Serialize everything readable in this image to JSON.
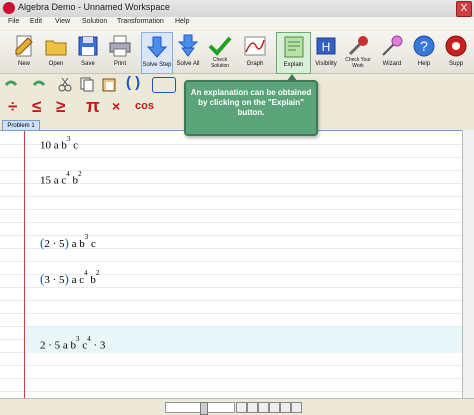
{
  "window": {
    "title": "Algebra Demo - Unnamed Workspace",
    "close": "X"
  },
  "menu": [
    "File",
    "Edit",
    "View",
    "Solution",
    "Transformation",
    "Help"
  ],
  "toolbar": {
    "new": "New",
    "open": "Open",
    "save": "Save",
    "print": "Print",
    "solve_step": "Solve Step",
    "solve_all": "Solve All",
    "check_solution": "Check Solution",
    "graph": "Graph",
    "explain": "Explain",
    "visibility": "Visibility",
    "check_your_work": "Check Your Work",
    "wizard": "Wizard",
    "help": "Help",
    "support": "Supp"
  },
  "symbols": {
    "divide": "÷",
    "leq": "≤",
    "geq": "≥",
    "pi": "π",
    "times": "×",
    "cos": "cos",
    "paren": "( )"
  },
  "tabs": [
    "Problem 1"
  ],
  "tooltip": "An explanation can be obtained by clicking on the \"Explain\" button.",
  "expressions": [
    {
      "id": "e1",
      "text": "10 a b",
      "e1": "3",
      "tail": "c"
    },
    {
      "id": "e2",
      "text": "15 a c",
      "e1": "4",
      "mid": "b",
      "e2": "2"
    },
    {
      "id": "e3",
      "n1": "2",
      "n2": "5",
      "text": "a b",
      "e1": "3",
      "tail": "c"
    },
    {
      "id": "e4",
      "n1": "3",
      "n2": "5",
      "text": "a c",
      "e1": "4",
      "mid": "b",
      "e2": "2"
    },
    {
      "id": "e5",
      "text": "2 · 5 a b",
      "e1": "3",
      "mid": "c",
      "e2": "4",
      "tail": "· 3"
    }
  ],
  "colors": {
    "accent": "#1c56c8",
    "red": "#c81818",
    "tooltip": "#5ba47a",
    "highlight": "#e8f6f8"
  }
}
